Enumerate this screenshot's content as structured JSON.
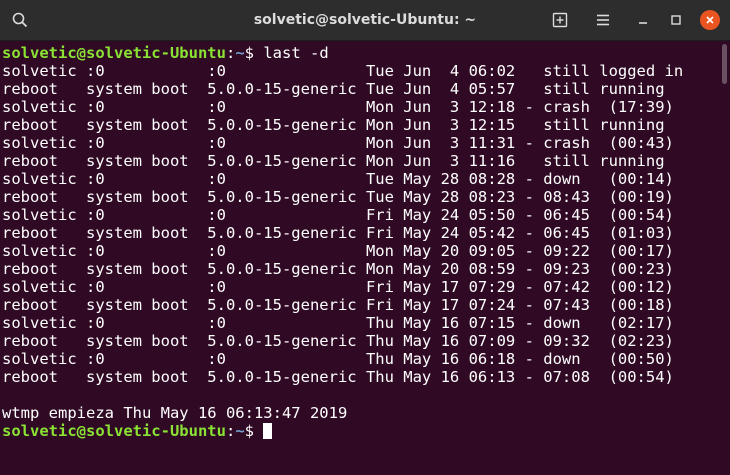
{
  "window": {
    "title": "solvetic@solvetic-Ubuntu: ~"
  },
  "prompt": {
    "user_host": "solvetic@solvetic-Ubuntu",
    "colon": ":",
    "path": "~",
    "symbol": "$ "
  },
  "command": "last -d",
  "rows": [
    "solvetic :0           :0               Tue Jun  4 06:02   still logged in",
    "reboot   system boot  5.0.0-15-generic Tue Jun  4 05:57   still running",
    "solvetic :0           :0               Mon Jun  3 12:18 - crash  (17:39)",
    "reboot   system boot  5.0.0-15-generic Mon Jun  3 12:15   still running",
    "solvetic :0           :0               Mon Jun  3 11:31 - crash  (00:43)",
    "reboot   system boot  5.0.0-15-generic Mon Jun  3 11:16   still running",
    "solvetic :0           :0               Tue May 28 08:28 - down   (00:14)",
    "reboot   system boot  5.0.0-15-generic Tue May 28 08:23 - 08:43  (00:19)",
    "solvetic :0           :0               Fri May 24 05:50 - 06:45  (00:54)",
    "reboot   system boot  5.0.0-15-generic Fri May 24 05:42 - 06:45  (01:03)",
    "solvetic :0           :0               Mon May 20 09:05 - 09:22  (00:17)",
    "reboot   system boot  5.0.0-15-generic Mon May 20 08:59 - 09:23  (00:23)",
    "solvetic :0           :0               Fri May 17 07:29 - 07:42  (00:12)",
    "reboot   system boot  5.0.0-15-generic Fri May 17 07:24 - 07:43  (00:18)",
    "solvetic :0           :0               Thu May 16 07:15 - down   (02:17)",
    "reboot   system boot  5.0.0-15-generic Thu May 16 07:09 - 09:32  (02:23)",
    "solvetic :0           :0               Thu May 16 06:18 - down   (00:50)",
    "reboot   system boot  5.0.0-15-generic Thu May 16 06:13 - 07:08  (00:54)"
  ],
  "footer": "wtmp empieza Thu May 16 06:13:47 2019",
  "icons": {
    "search": "search-icon",
    "new_tab": "new-tab-icon",
    "menu": "hamburger-menu-icon",
    "minimize": "minimize-icon",
    "maximize": "maximize-icon",
    "close": "close-icon"
  },
  "colors": {
    "background": "#300a24",
    "prompt_user": "#8ae234",
    "prompt_path": "#729fcf",
    "text": "#ffffff",
    "close_button": "#e95420"
  }
}
